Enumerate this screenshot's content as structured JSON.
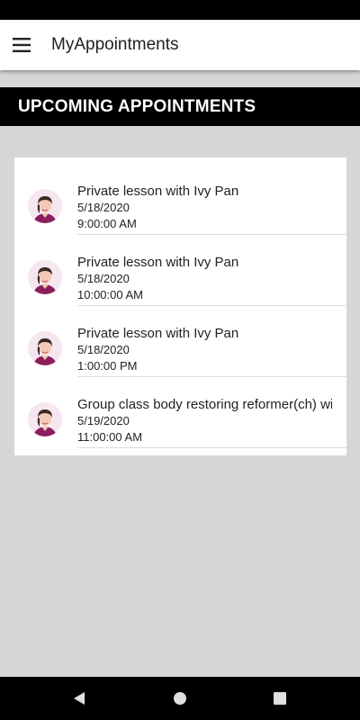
{
  "app_bar": {
    "title": "MyAppointments",
    "menu_icon": "hamburger-menu-icon"
  },
  "section": {
    "title": "UPCOMING APPOINTMENTS"
  },
  "appointments": [
    {
      "title": "Private lesson with Ivy Pan",
      "date": "5/18/2020",
      "time": "9:00:00 AM"
    },
    {
      "title": "Private lesson with Ivy Pan",
      "date": "5/18/2020",
      "time": "10:00:00 AM"
    },
    {
      "title": "Private lesson with Ivy Pan",
      "date": "5/18/2020",
      "time": "1:00:00 PM"
    },
    {
      "title": "Group class body restoring reformer(ch) with Ivy Pan",
      "date": "5/19/2020",
      "time": "11:00:00 AM"
    }
  ],
  "nav_bar": {
    "icons": [
      "back-triangle-icon",
      "home-circle-icon",
      "recents-square-icon"
    ]
  },
  "colors": {
    "header_bg": "#000000",
    "page_bg": "#d6d6d6",
    "card_bg": "#ffffff",
    "avatar_accent": "#8a1f5c"
  }
}
